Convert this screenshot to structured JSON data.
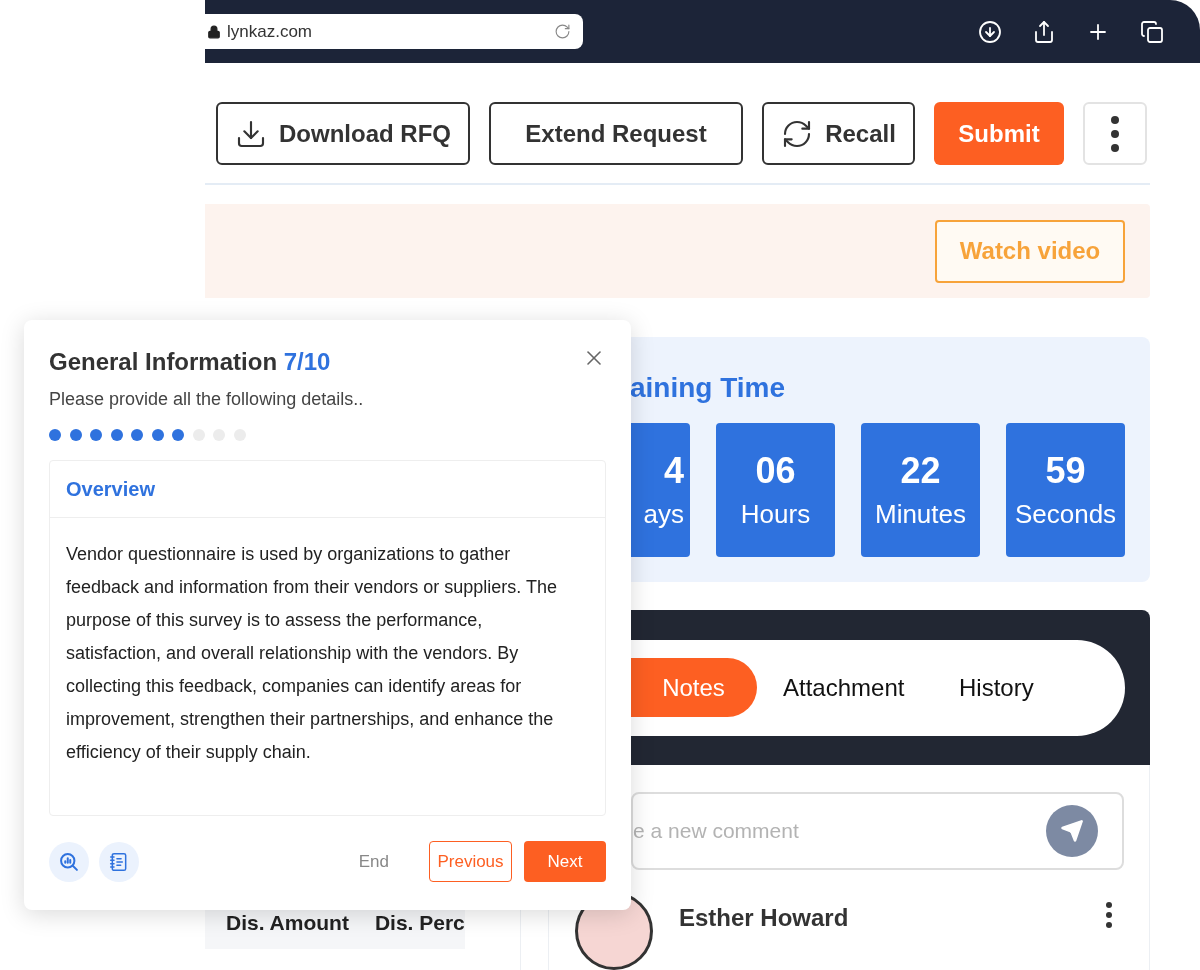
{
  "browser": {
    "url": "lynkaz.com"
  },
  "toolbar": {
    "buttons": [
      {
        "kind": "download",
        "label": "Download RFQ"
      },
      {
        "kind": "plain",
        "label": "Extend Request"
      },
      {
        "kind": "recall",
        "label": "Recall"
      },
      {
        "kind": "primary",
        "label": "Submit"
      },
      {
        "kind": "more"
      }
    ]
  },
  "banner": {
    "button": "Watch video"
  },
  "timer": {
    "title": "aining Time",
    "units": [
      {
        "value": "4",
        "label": "ays",
        "partial": true
      },
      {
        "value": "06",
        "label": "Hours",
        "partial": false
      },
      {
        "value": "22",
        "label": "Minutes",
        "partial": false
      },
      {
        "value": "59",
        "label": "Seconds",
        "partial": false
      }
    ]
  },
  "notes": {
    "tabs": [
      {
        "label": "Notes",
        "selected": true
      },
      {
        "label": "Attachment",
        "selected": false
      },
      {
        "label": "History",
        "selected": false
      }
    ],
    "comment": {
      "placeholder": "e a new comment"
    },
    "comments": [
      {
        "author": "Esther Howard"
      }
    ]
  },
  "table": {
    "columns": [
      "Dis. Amount",
      "Dis. Perc"
    ]
  },
  "dialog": {
    "title": "General Information",
    "step": "7/10",
    "subtitle": "Please provide all the following details..",
    "steps": [
      {
        "done": true
      },
      {
        "done": true
      },
      {
        "done": true
      },
      {
        "done": true
      },
      {
        "done": true
      },
      {
        "done": true
      },
      {
        "done": true
      },
      {
        "done": false
      },
      {
        "done": false
      },
      {
        "done": false
      }
    ],
    "section": {
      "title": "Overview",
      "body": "Vendor questionnaire is used by organizations to gather feedback and information from their vendors or suppliers. The purpose of this survey is to assess the performance, satisfaction, and overall relationship with the vendors. By collecting this feedback, companies can identify areas for improvement, strengthen their partnerships, and enhance the efficiency of their supply chain."
    },
    "actions": {
      "end": "End",
      "previous": "Previous",
      "next": "Next"
    }
  }
}
